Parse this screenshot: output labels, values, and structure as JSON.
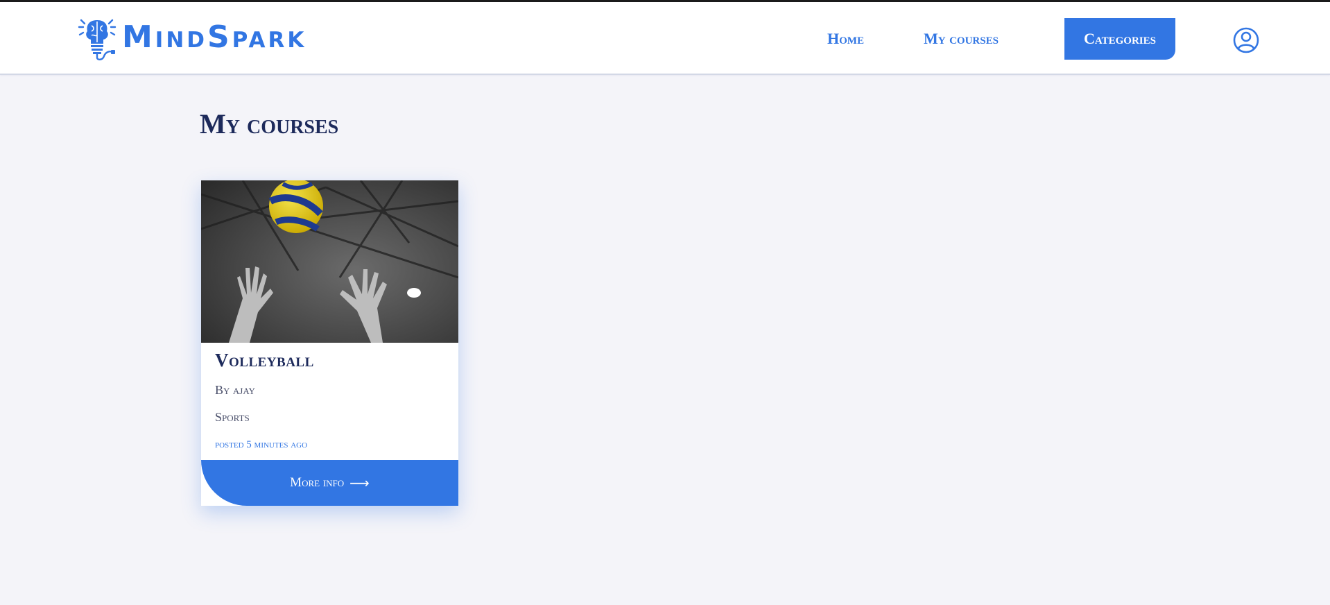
{
  "brand": {
    "name": "MindSpark",
    "accent_color": "#3276e3",
    "dark_color": "#1d2a5b"
  },
  "nav": {
    "home_label": "Home",
    "my_courses_label": "My courses",
    "categories_label": "Categories",
    "user_icon": "user-circle-icon"
  },
  "page": {
    "title": "My courses"
  },
  "courses": [
    {
      "title": "Volleyball",
      "author": "By ajay",
      "category": "Sports",
      "posted": "posted 5 minutes ago",
      "button_label": "More info",
      "button_icon": "arrow-right-icon",
      "image": "volleyball-photo"
    }
  ]
}
